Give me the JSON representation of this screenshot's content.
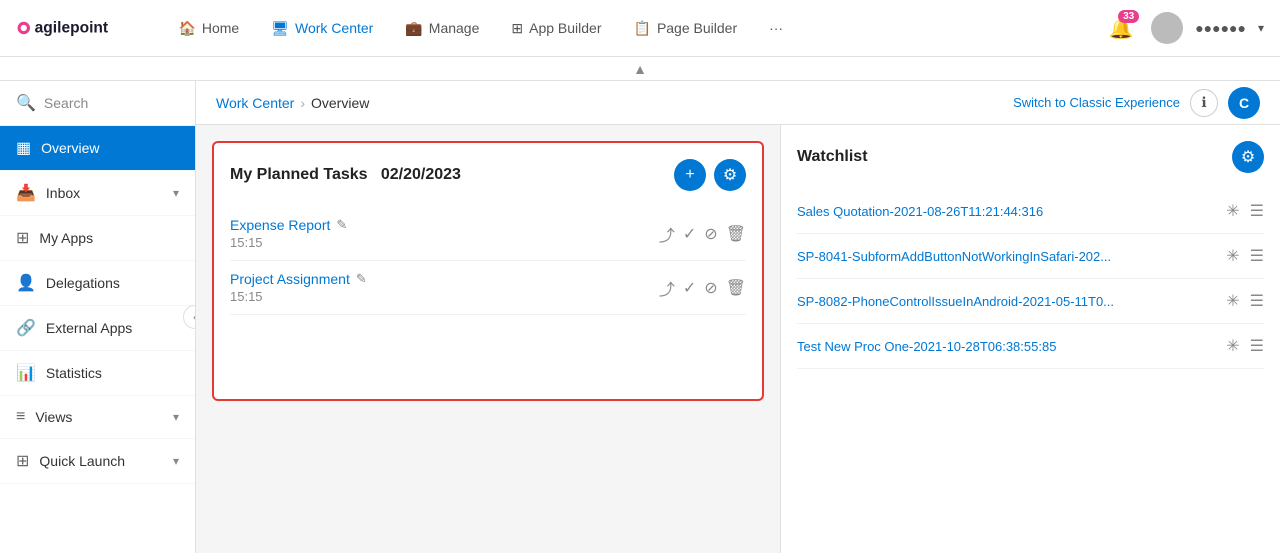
{
  "brand": {
    "logo_text": "agilepoint"
  },
  "topnav": {
    "items": [
      {
        "label": "Home",
        "icon": "🏠",
        "active": false
      },
      {
        "label": "Work Center",
        "icon": "🖥",
        "active": true
      },
      {
        "label": "Manage",
        "icon": "💼",
        "active": false
      },
      {
        "label": "App Builder",
        "icon": "⊞",
        "active": false
      },
      {
        "label": "Page Builder",
        "icon": "📋",
        "active": false
      },
      {
        "label": "···",
        "icon": "",
        "active": false
      }
    ],
    "notif_count": "33",
    "user_name": "●●●●●●"
  },
  "sidebar": {
    "search_placeholder": "Search",
    "items": [
      {
        "label": "Overview",
        "icon": "▦",
        "active": true,
        "has_arrow": false
      },
      {
        "label": "Inbox",
        "icon": "📥",
        "active": false,
        "has_arrow": true
      },
      {
        "label": "My Apps",
        "icon": "⊞",
        "active": false,
        "has_arrow": false
      },
      {
        "label": "Delegations",
        "icon": "👤",
        "active": false,
        "has_arrow": false
      },
      {
        "label": "External Apps",
        "icon": "🔗",
        "active": false,
        "has_arrow": false
      },
      {
        "label": "Statistics",
        "icon": "📊",
        "active": false,
        "has_arrow": false
      },
      {
        "label": "Views",
        "icon": "≡",
        "active": false,
        "has_arrow": true
      },
      {
        "label": "Quick Launch",
        "icon": "⊞",
        "active": false,
        "has_arrow": true
      }
    ]
  },
  "breadcrumb": {
    "parent": "Work Center",
    "current": "Overview",
    "switch_label": "Switch to Classic Experience"
  },
  "tasks_panel": {
    "title": "My Planned Tasks",
    "date": "02/20/2023",
    "tasks": [
      {
        "name": "Expense Report",
        "time": "15:15"
      },
      {
        "name": "Project Assignment",
        "time": "15:15"
      }
    ]
  },
  "watchlist_panel": {
    "title": "Watchlist",
    "items": [
      {
        "name": "Sales Quotation-2021-08-26T11:21:44:316"
      },
      {
        "name": "SP-8041-SubformAddButtonNotWorkingInSafari-202..."
      },
      {
        "name": "SP-8082-PhoneControlIssueInAndroid-2021-05-11T0..."
      },
      {
        "name": "Test New Proc One-2021-10-28T06:38:55:85"
      }
    ]
  },
  "user_circle_label": "C"
}
